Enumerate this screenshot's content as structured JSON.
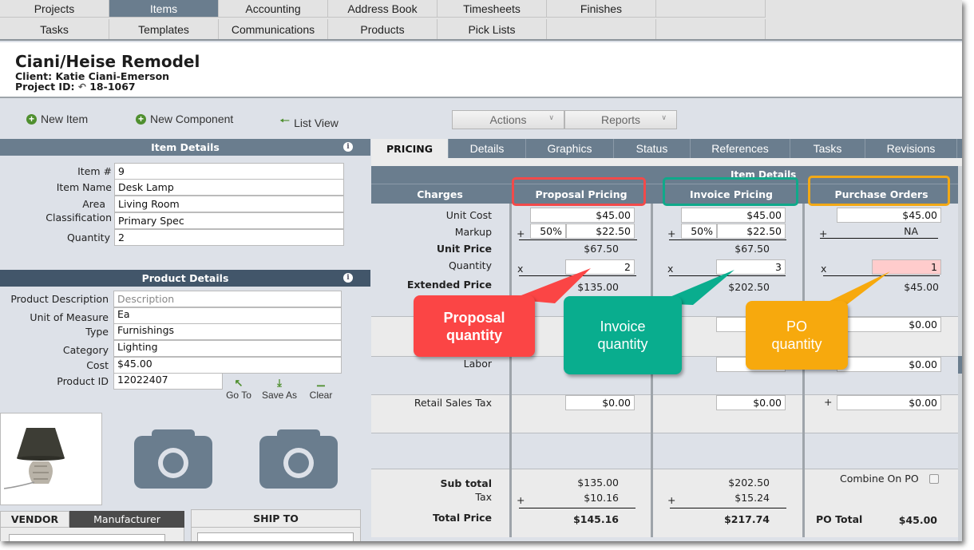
{
  "nav": {
    "row1": [
      "Projects",
      "Items",
      "Accounting",
      "Address Book",
      "Timesheets",
      "Finishes",
      ""
    ],
    "row2": [
      "Tasks",
      "Templates",
      "Communications",
      "Products",
      "Pick Lists",
      "",
      ""
    ],
    "active": "Items"
  },
  "project": {
    "title": "Ciani/Heise Remodel",
    "client": "Client: Katie Ciani-Emerson",
    "project_id_label": "Project ID:",
    "project_id": "18-1067"
  },
  "toolbar": {
    "new_item": "New Item",
    "new_component": "New Component",
    "list_view": "List View",
    "actions": "Actions",
    "reports": "Reports"
  },
  "item_details": {
    "title": "Item Details",
    "fields": [
      {
        "label": "Item #",
        "value": "9"
      },
      {
        "label": "Item Name",
        "value": "Desk Lamp"
      },
      {
        "label": "Area",
        "value": "Living Room"
      },
      {
        "label": "Classification",
        "value": "Primary Spec"
      },
      {
        "label": "Quantity",
        "value": "2"
      }
    ]
  },
  "product_details": {
    "title": "Product Details",
    "fields": [
      {
        "label": "Product Description",
        "value": "",
        "placeholder": "Description"
      },
      {
        "label": "Unit of Measure",
        "value": "Ea"
      },
      {
        "label": "Type",
        "value": "Furnishings"
      },
      {
        "label": "Category",
        "value": "Lighting"
      },
      {
        "label": "Cost",
        "value": "$45.00"
      },
      {
        "label": "Product ID",
        "value": "12022407"
      }
    ],
    "actions": {
      "goto": "Go To",
      "save_as": "Save As",
      "clear": "Clear"
    }
  },
  "vendor_tabs": {
    "vendor": "VENDOR",
    "manufacturer": "Manufacturer",
    "ship_to": "SHIP TO"
  },
  "tabs": [
    "PRICING",
    "Details",
    "Graphics",
    "Status",
    "References",
    "Tasks",
    "Revisions"
  ],
  "pricing": {
    "section_title": "Item Details",
    "charges_header": "Charges",
    "columns": [
      "Proposal Pricing",
      "Invoice Pricing",
      "Purchase Orders"
    ],
    "labels": {
      "unit_cost": "Unit Cost",
      "markup": "Markup",
      "unit_price": "Unit Price",
      "quantity": "Quantity",
      "extended_price": "Extended Price",
      "labor": "Labor",
      "retail_sales_tax": "Retail Sales Tax",
      "sub_total": "Sub total",
      "tax": "Tax",
      "total_price": "Total Price"
    },
    "proposal": {
      "unit_cost": "$45.00",
      "markup_pct": "50%",
      "markup_amt": "$22.50",
      "unit_price": "$67.50",
      "quantity": "2",
      "extended_price": "$135.00",
      "retail_sales_tax": "$0.00",
      "sub_total": "$135.00",
      "tax": "$10.16",
      "total": "$145.16"
    },
    "invoice": {
      "unit_cost": "$45.00",
      "markup_pct": "50%",
      "markup_amt": "$22.50",
      "unit_price": "$67.50",
      "quantity": "3",
      "extended_price": "$202.50",
      "retail_sales_tax": "$0.00",
      "sub_total": "$202.50",
      "tax": "$15.24",
      "total": "$217.74"
    },
    "po": {
      "unit_cost": "$45.00",
      "markup": "NA",
      "quantity": "1",
      "extended_price": "$45.00",
      "row_a": "$0.00",
      "labor": "$0.00",
      "retail_sales_tax": "$0.00",
      "combine_label": "Combine On PO",
      "total_label": "PO Total",
      "total": "$45.00"
    },
    "ops": {
      "plus": "+",
      "times": "x"
    }
  },
  "callouts": {
    "proposal": "Proposal quantity",
    "invoice": "Invoice quantity",
    "po": "PO quantity",
    "colors": {
      "red": "#fb4545",
      "teal": "#09ad8e",
      "orange": "#f7a90d"
    }
  }
}
